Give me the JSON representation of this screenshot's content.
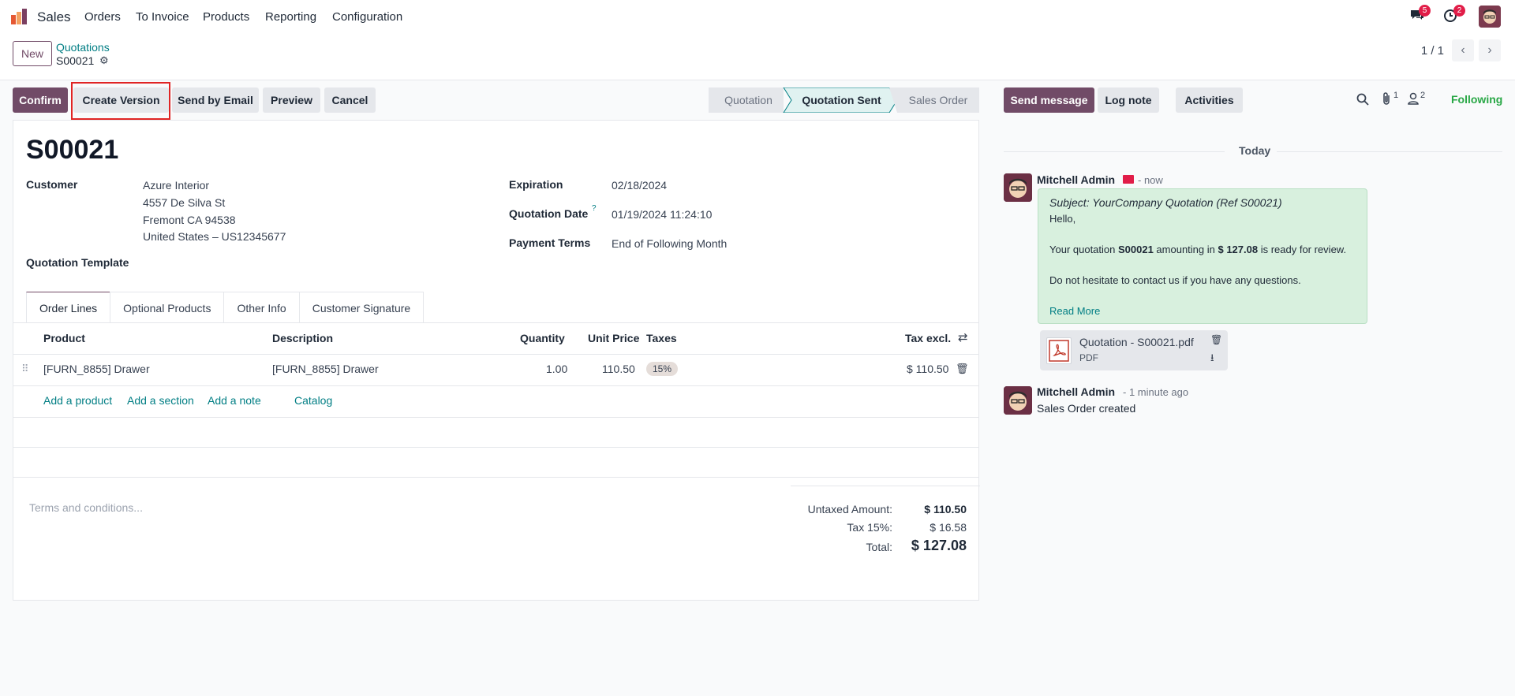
{
  "nav": {
    "app": "Sales",
    "menu": [
      "Orders",
      "To Invoice",
      "Products",
      "Reporting",
      "Configuration"
    ],
    "messages_badge": "5",
    "activities_badge": "2"
  },
  "control": {
    "new_label": "New",
    "breadcrumb_parent": "Quotations",
    "breadcrumb_current": "S00021",
    "pager": "1 / 1"
  },
  "actions": {
    "confirm": "Confirm",
    "create_version": "Create Version",
    "send_email": "Send by Email",
    "preview": "Preview",
    "cancel": "Cancel"
  },
  "statusbar": [
    "Quotation",
    "Quotation Sent",
    "Sales Order"
  ],
  "form": {
    "title": "S00021",
    "customer_label": "Customer",
    "customer_name": "Azure Interior",
    "customer_addr1": "4557 De Silva St",
    "customer_addr2": "Fremont CA 94538",
    "customer_addr3": "United States – US12345677",
    "template_label": "Quotation Template",
    "expiration_label": "Expiration",
    "expiration_value": "02/18/2024",
    "qdate_label": "Quotation Date",
    "qdate_help": "?",
    "qdate_value": "01/19/2024 11:24:10",
    "terms_label": "Payment Terms",
    "terms_value": "End of Following Month"
  },
  "tabs": [
    "Order Lines",
    "Optional Products",
    "Other Info",
    "Customer Signature"
  ],
  "table": {
    "headers": {
      "product": "Product",
      "description": "Description",
      "quantity": "Quantity",
      "unit_price": "Unit Price",
      "taxes": "Taxes",
      "tax_excl": "Tax excl."
    },
    "row": {
      "product": "[FURN_8855] Drawer",
      "description": "[FURN_8855] Drawer",
      "quantity": "1.00",
      "unit_price": "110.50",
      "tax": "15%",
      "subtotal": "$ 110.50"
    },
    "add_product": "Add a product",
    "add_section": "Add a section",
    "add_note": "Add a note",
    "catalog": "Catalog"
  },
  "terms_placeholder": "Terms and conditions...",
  "totals": {
    "untaxed_label": "Untaxed Amount:",
    "untaxed_value": "$ 110.50",
    "tax_label": "Tax 15%:",
    "tax_value": "$ 16.58",
    "total_label": "Total:",
    "total_value": "$ 127.08"
  },
  "chatter": {
    "send_message": "Send message",
    "log_note": "Log note",
    "activities": "Activities",
    "attachments_count": "1",
    "followers_count": "2",
    "following": "Following",
    "today": "Today",
    "msg1_author": "Mitchell Admin",
    "msg1_time": "- now",
    "msg1_subject": "Subject: YourCompany Quotation (Ref S00021)",
    "msg1_hello": "Hello,",
    "msg1_body_a": "Your quotation ",
    "msg1_body_ref": "S00021",
    "msg1_body_b": " amounting in ",
    "msg1_body_amt": "$ 127.08",
    "msg1_body_c": " is ready for review.",
    "msg1_body2": "Do not hesitate to contact us if you have any questions.",
    "read_more": "Read More",
    "attachment_name": "Quotation - S00021.pdf",
    "attachment_type": "PDF",
    "msg2_author": "Mitchell Admin",
    "msg2_time": "- 1 minute ago",
    "msg2_body": "Sales Order created"
  }
}
